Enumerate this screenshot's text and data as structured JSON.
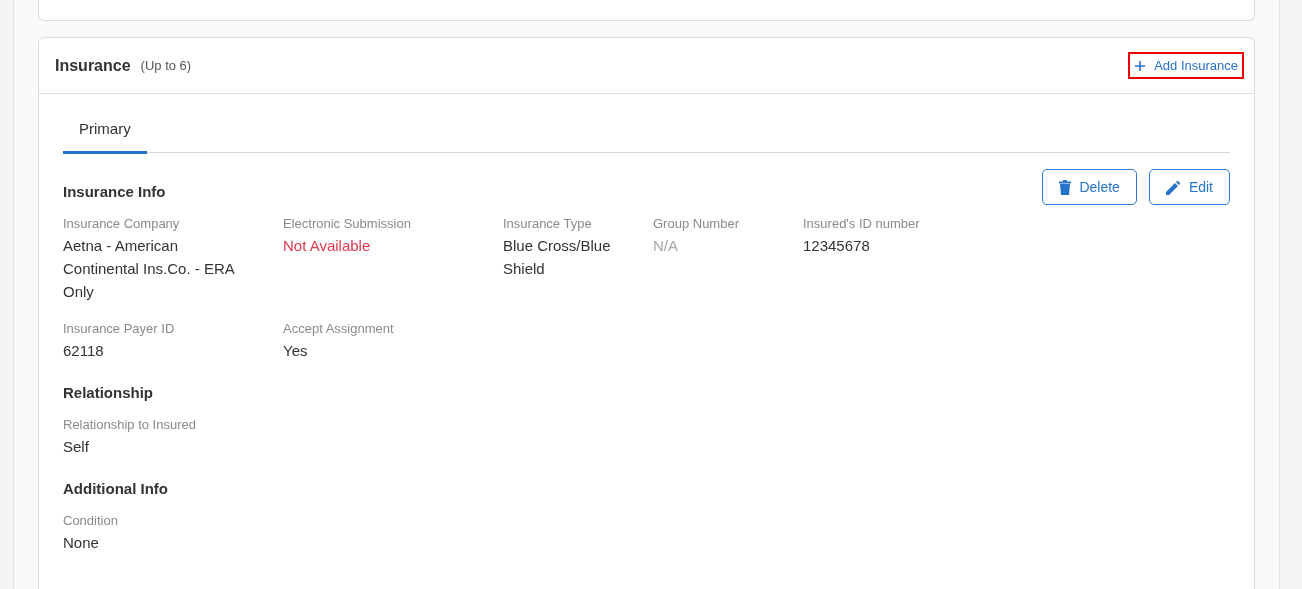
{
  "section": {
    "title": "Insurance",
    "subtitle": "(Up to 6)",
    "add_button": {
      "label": "Add Insurance",
      "highlighted": true
    }
  },
  "tabs": [
    {
      "label": "Primary",
      "selected": true
    }
  ],
  "actions": [
    {
      "kind": "delete",
      "label": "Delete"
    },
    {
      "kind": "edit",
      "label": "Edit"
    }
  ],
  "groups": [
    {
      "title": "Insurance Info",
      "rows": [
        [
          {
            "label": "Insurance Company",
            "value": "Aetna - American Continental Ins.Co. - ERA Only",
            "kind": "normal"
          },
          {
            "label": "Electronic Submission",
            "value": "Not Available",
            "kind": "error"
          },
          {
            "label": "Insurance Type",
            "value": "Blue Cross/Blue Shield",
            "kind": "normal"
          },
          {
            "label": "Group Number",
            "value": "N/A",
            "kind": "muted"
          },
          {
            "label": "Insured's ID number",
            "value": "12345678",
            "kind": "normal"
          }
        ],
        [
          {
            "label": "Insurance Payer ID",
            "value": "62118",
            "kind": "normal"
          },
          {
            "label": "Accept Assignment",
            "value": "Yes",
            "kind": "normal"
          }
        ]
      ]
    },
    {
      "title": "Relationship",
      "rows": [
        [
          {
            "label": "Relationship to Insured",
            "value": "Self",
            "kind": "normal"
          }
        ]
      ]
    },
    {
      "title": "Additional Info",
      "rows": [
        [
          {
            "label": "Condition",
            "value": "None",
            "kind": "normal"
          }
        ]
      ]
    }
  ]
}
